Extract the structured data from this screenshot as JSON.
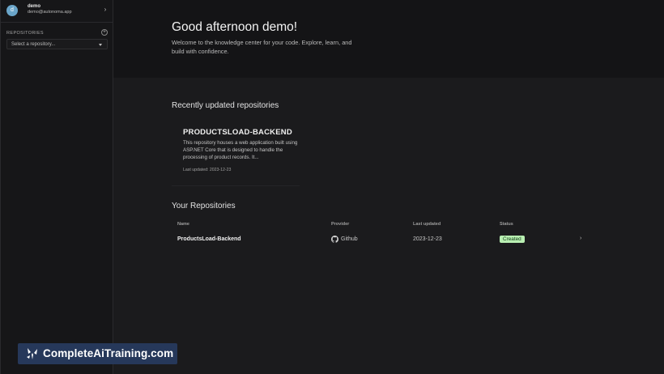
{
  "user": {
    "avatar_initial": "d",
    "name": "demo",
    "email": "demo@autonoma.app"
  },
  "sidebar": {
    "repositories_label": "REPOSITORIES",
    "select_placeholder": "Select a repository..."
  },
  "hero": {
    "greeting": "Good afternoon demo!",
    "subtext": "Welcome to the knowledge center for your code. Explore, learn, and build with confidence."
  },
  "recent": {
    "title": "Recently updated repositories",
    "card": {
      "title": "PRODUCTSLOAD-BACKEND",
      "description": "This repository houses a web application built using ASP.NET Core that is designed to handle the processing of product records. It...",
      "last_updated": "Last updated: 2023-12-23"
    }
  },
  "repositories": {
    "title": "Your Repositories",
    "columns": [
      "Name",
      "Provider",
      "Last updated",
      "Status"
    ],
    "rows": [
      {
        "name": "ProductsLoad-Backend",
        "provider": "Github",
        "last_updated": "2023-12-23",
        "status": "Created"
      }
    ]
  },
  "watermark": {
    "text": "CompleteAiTraining.com"
  },
  "colors": {
    "status_created_bg": "#b9efb2",
    "watermark_bg": "#26385a",
    "avatar_bg": "#6aa5c9"
  }
}
